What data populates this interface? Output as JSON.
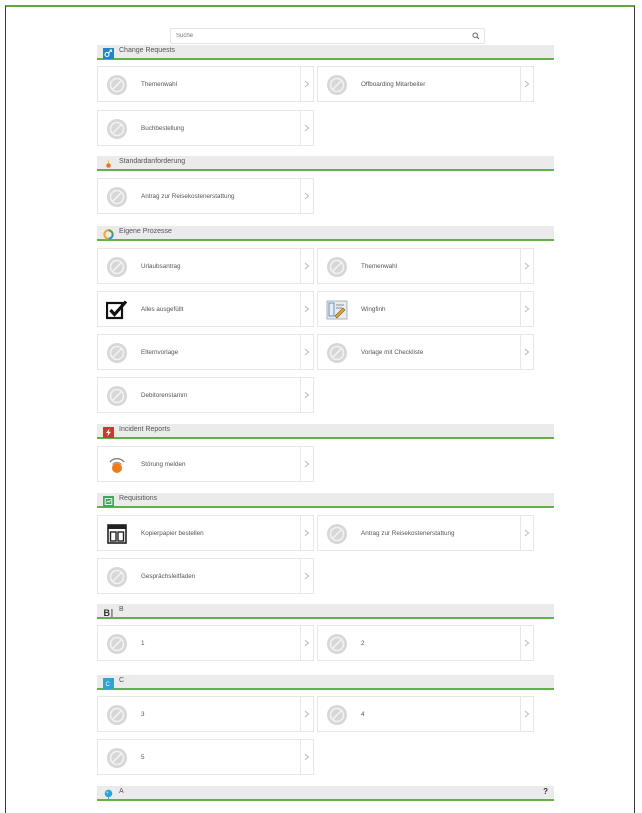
{
  "search": {
    "placeholder": "Suche",
    "icon": "search-icon"
  },
  "sections": [
    {
      "title": "Change Requests",
      "icon": "change-requests-icon",
      "color": "#1f87c9",
      "tiles": [
        {
          "label": "Themenwahl",
          "icon": "default-process-icon"
        },
        {
          "label": "Offboarding Mitarbeiter",
          "icon": "default-process-icon"
        },
        {
          "label": "Buchbestellung",
          "icon": "default-process-icon"
        }
      ]
    },
    {
      "title": "Standardanforderung",
      "icon": "standard-request-icon",
      "color": "#e8732a",
      "tiles": [
        {
          "label": "Antrag zur Reisekostenerstattung",
          "icon": "default-process-icon"
        }
      ]
    },
    {
      "title": "Eigene Prozesse",
      "icon": "own-processes-icon",
      "color": "#f5a623",
      "tiles": [
        {
          "label": "Urlaubsantrag",
          "icon": "default-process-icon"
        },
        {
          "label": "Themenwahl",
          "icon": "default-process-icon"
        },
        {
          "label": "Alles ausgefüllt",
          "icon": "checkbox-checked-icon"
        },
        {
          "label": "Wingfinh",
          "icon": "edit-document-icon"
        },
        {
          "label": "Elternvorlage",
          "icon": "default-process-icon"
        },
        {
          "label": "Vorlage mit Checkliste",
          "icon": "default-process-icon"
        },
        {
          "label": "Debitorenstamm",
          "icon": "default-process-icon"
        }
      ]
    },
    {
      "title": "Incident Reports",
      "icon": "incident-icon",
      "color": "#d9312b",
      "tiles": [
        {
          "label": "Störung melden",
          "icon": "alarm-signal-icon"
        }
      ]
    },
    {
      "title": "Requisitions",
      "icon": "requisitions-icon",
      "color": "#3fa85a",
      "tiles": [
        {
          "label": "Kopierpapier bestellen",
          "icon": "printer-paper-icon"
        },
        {
          "label": "Antrag zur Reisekostenerstattung",
          "icon": "default-process-icon"
        },
        {
          "label": "Gesprächsleitfaden",
          "icon": "default-process-icon"
        }
      ]
    },
    {
      "title": "B",
      "icon": "b-letter-icon",
      "color": "#333333",
      "tiles": [
        {
          "label": "1",
          "icon": "default-process-icon"
        },
        {
          "label": "2",
          "icon": "default-process-icon"
        }
      ]
    },
    {
      "title": "C",
      "icon": "c-letter-icon",
      "color": "#2aa6d6",
      "tiles": [
        {
          "label": "3",
          "icon": "default-process-icon"
        },
        {
          "label": "4",
          "icon": "default-process-icon"
        },
        {
          "label": "5",
          "icon": "default-process-icon"
        }
      ]
    },
    {
      "title": "A",
      "icon": "a-balloon-icon",
      "color": "#2aa6d6",
      "help": "?",
      "tiles": []
    }
  ],
  "colors": {
    "accent_green": "#63b04a",
    "header_bg": "#ebebeb",
    "tile_border": "#e7e7e7"
  }
}
